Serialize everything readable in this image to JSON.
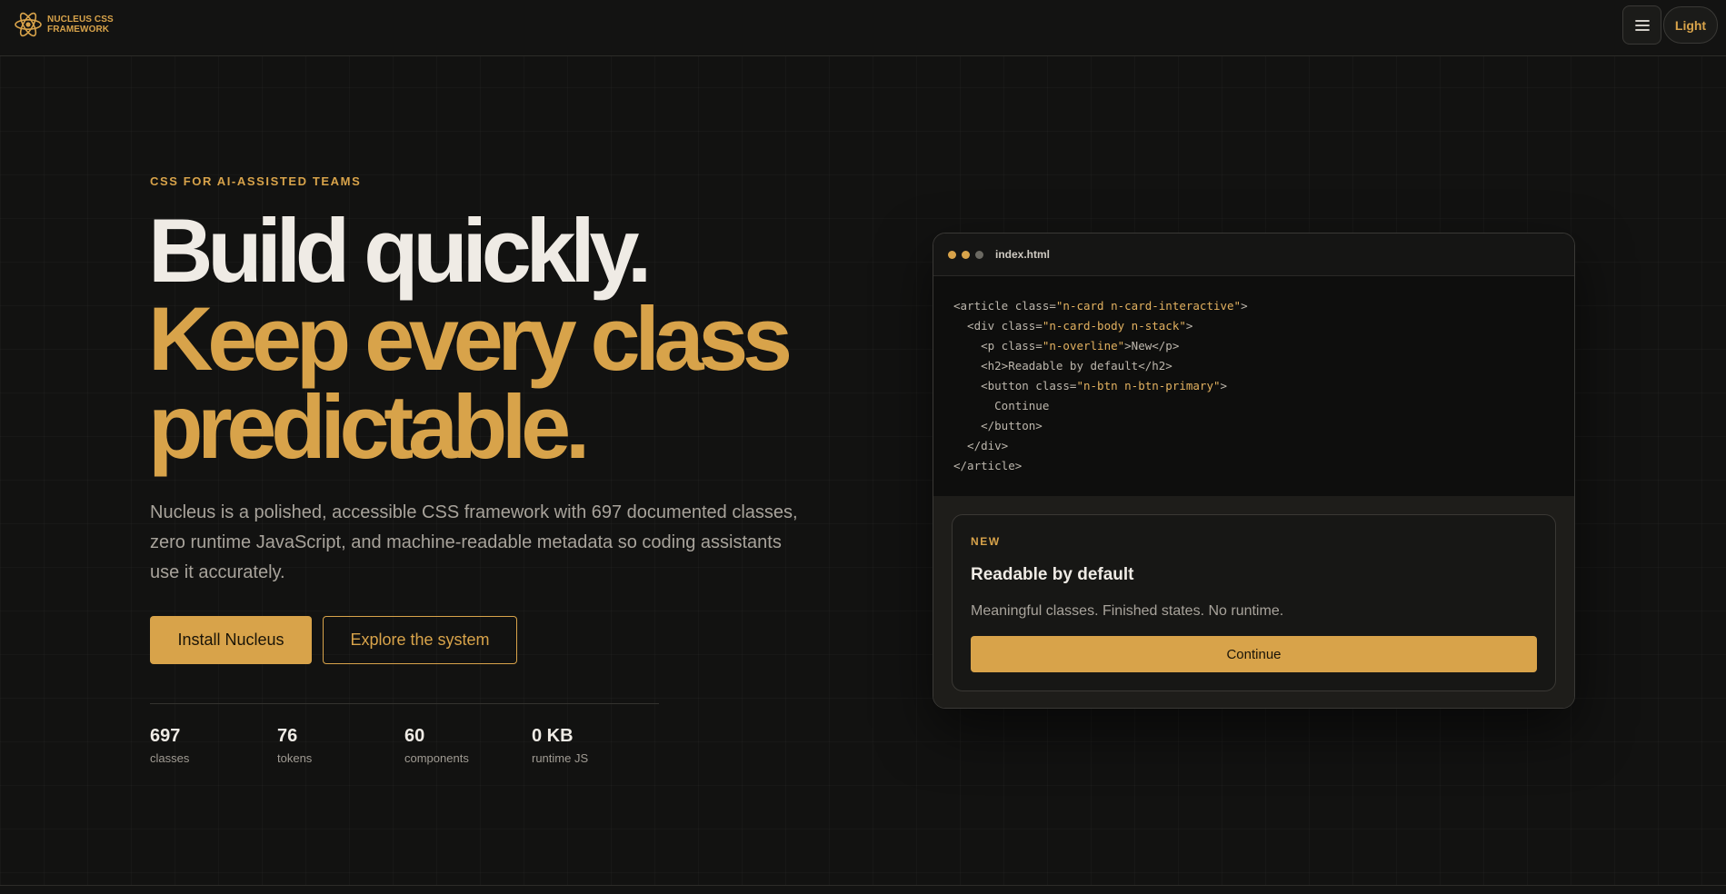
{
  "header": {
    "brand_name": "NUCLEUS CSS FRAMEWORK",
    "brand_line1": "NUCLEUS CSS",
    "brand_line2": "FRAMEWORK",
    "menu_icon": "hamburger-menu-icon",
    "theme_toggle_label": "Light"
  },
  "hero": {
    "overline": "CSS FOR AI-ASSISTED TEAMS",
    "headline_line1": "Build quickly.",
    "headline_line2": "Keep every class",
    "headline_line3": "predictable.",
    "lede": "Nucleus is a polished, accessible CSS framework with 697 documented classes, zero runtime JavaScript, and machine-readable metadata so coding assistants use it accurately.",
    "primary_cta": "Install Nucleus",
    "secondary_cta": "Explore the system",
    "stats": [
      {
        "value": "697",
        "label": "classes"
      },
      {
        "value": "76",
        "label": "tokens"
      },
      {
        "value": "60",
        "label": "components"
      },
      {
        "value": "0 KB",
        "label": "runtime JS"
      }
    ]
  },
  "preview": {
    "filename": "index.html",
    "code_lines": [
      "<article class=\"n-card n-card-interactive\">",
      "  <div class=\"n-card-body n-stack\">",
      "    <p class=\"n-overline\">New</p>",
      "    <h2>Readable by default</h2>",
      "    <button class=\"n-btn n-btn-primary\">",
      "      Continue",
      "    </button>",
      "  </div>",
      "</article>"
    ],
    "card": {
      "overline": "NEW",
      "title": "Readable by default",
      "text": "Meaningful classes. Finished states. No runtime.",
      "button": "Continue"
    }
  },
  "colors": {
    "accent": "#d8a34a",
    "background": "#121211",
    "text": "#ece8e1",
    "muted_text": "#a8a39b",
    "window_dot_1": "#d8a34a",
    "window_dot_2": "#d8a34a",
    "window_dot_3": "#6b6962"
  }
}
